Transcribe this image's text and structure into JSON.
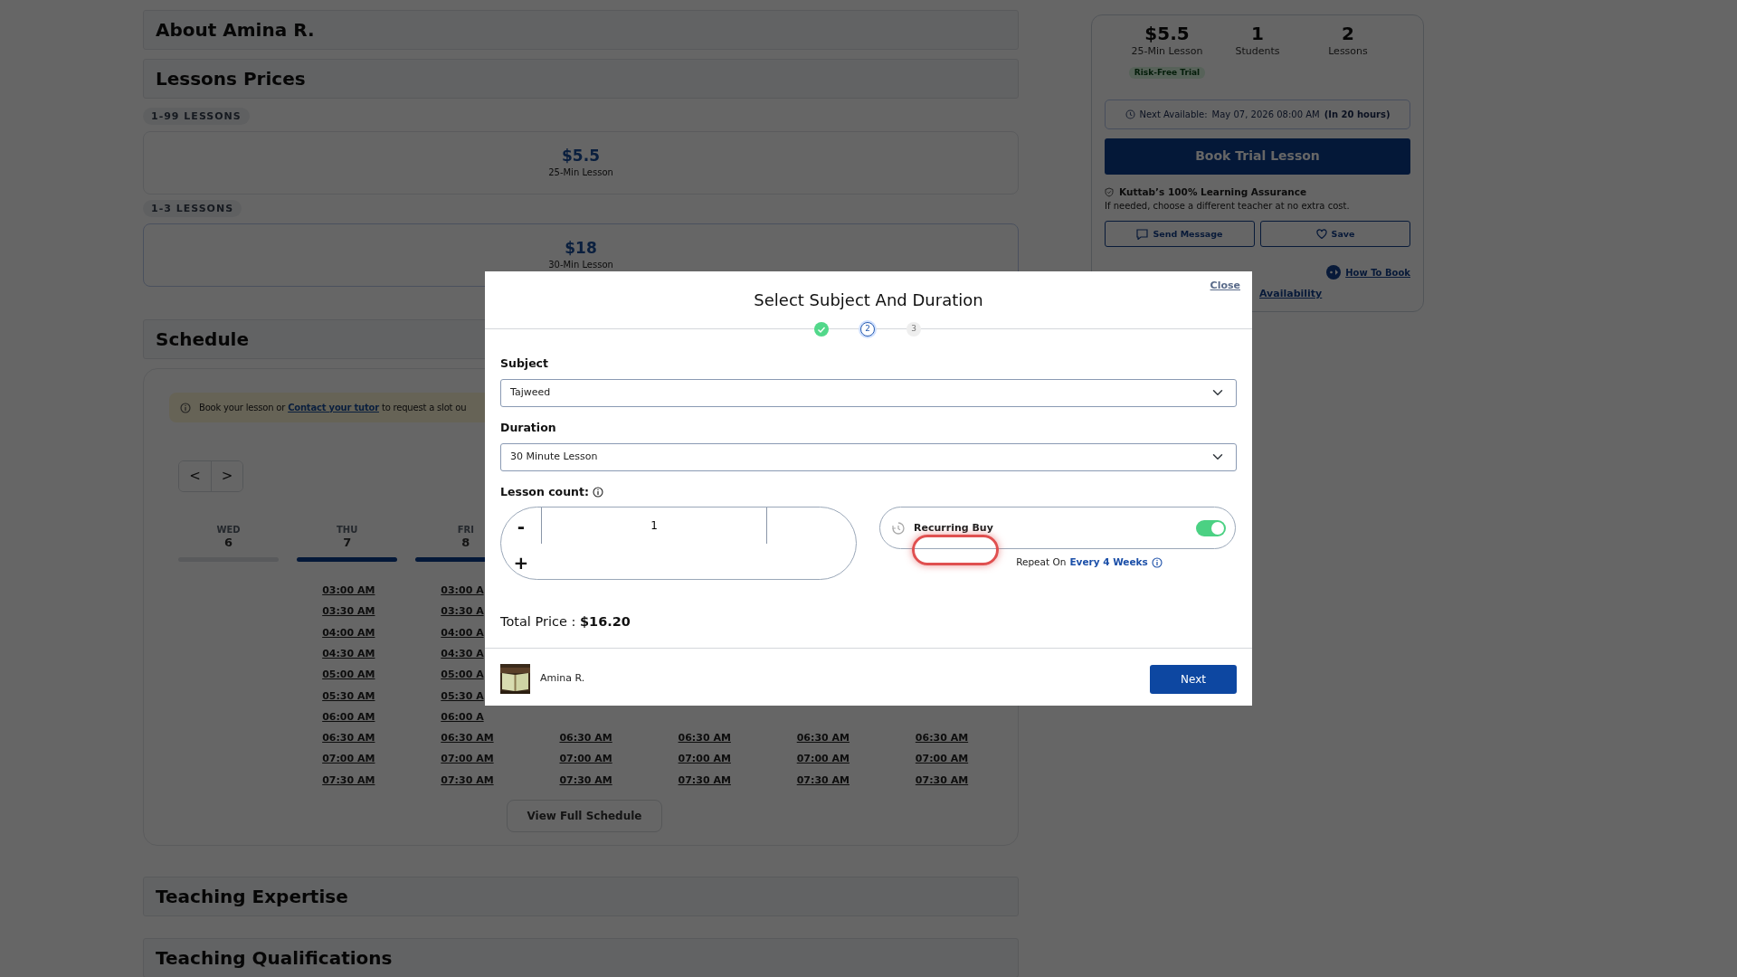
{
  "sections_top": [
    {
      "title": "About Amina R."
    },
    {
      "title": "Lessons Prices"
    }
  ],
  "price_tiers": [
    {
      "label": "1-99 LESSONS",
      "price": "$5.5",
      "unit": "25-Min Lesson",
      "selected": false
    },
    {
      "label": "1-3 LESSONS",
      "price": "$18",
      "unit": "30-Min Lesson",
      "selected": true
    }
  ],
  "schedule": {
    "title": "Schedule",
    "notice": {
      "before": "Book your lesson or ",
      "link": "Contact your tutor",
      "after": " to request a slot ou"
    },
    "prev": "<",
    "next": ">",
    "days": [
      {
        "weekday": "WED",
        "date": "6",
        "available": false
      },
      {
        "weekday": "THU",
        "date": "7",
        "available": true,
        "times": [
          "03:00 AM",
          "03:30 AM",
          "04:00 AM",
          "04:30 AM",
          "05:00 AM",
          "05:30 AM",
          "06:00 AM",
          "06:30 AM",
          "07:00 AM",
          "07:30 AM"
        ]
      },
      {
        "weekday": "FRI",
        "date": "8",
        "available": true,
        "times": [
          "03:00 A",
          "03:30 A",
          "04:00 A",
          "04:30 A",
          "05:00 A",
          "05:30 A",
          "06:00 A",
          "06:30 AM",
          "07:00 AM",
          "07:30 AM"
        ]
      },
      {
        "times": [
          "06:30 AM",
          "07:00 AM",
          "07:30 AM"
        ]
      },
      {
        "times": [
          "06:30 AM",
          "07:00 AM",
          "07:30 AM"
        ]
      },
      {
        "times": [
          "06:30 AM",
          "07:00 AM",
          "07:30 AM"
        ]
      },
      {
        "times": [
          "06:30 AM",
          "07:00 AM",
          "07:30 AM"
        ]
      }
    ],
    "full_button": "View Full Schedule"
  },
  "sections_bottom": [
    {
      "title": "Teaching Expertise"
    },
    {
      "title": "Teaching Qualifications"
    }
  ],
  "summary": {
    "stats": [
      {
        "value": "$5.5",
        "label": "25-Min Lesson",
        "badge": "Risk-Free Trial"
      },
      {
        "value": "1",
        "label": "Students"
      },
      {
        "value": "2",
        "label": "Lessons"
      }
    ],
    "next_available": {
      "label": "Next Available:",
      "date": "May 07, 2026 08:00 AM",
      "relative": "(In 20 hours)"
    },
    "book_button": "Book Trial Lesson",
    "assurance_title": "Kuttab’s 100% Learning Assurance",
    "assurance_text": "If needed, choose a different teacher at no extra cost.",
    "message_button": "Send Message",
    "save_button": "Save",
    "how_link": "How To Book",
    "availability_link": "Availability"
  },
  "modal": {
    "title": "Select Subject And Duration",
    "close": "Close",
    "steps": [
      {
        "done": true,
        "selected": false
      },
      {
        "label": "2",
        "done": false,
        "selected": true
      },
      {
        "label": "3",
        "done": false,
        "selected": false
      }
    ],
    "subject_label": "Subject",
    "subject": "Tajweed",
    "duration_label": "Duration",
    "duration": "30 Minute Lesson",
    "count_label": "Lesson count:",
    "minus": "-",
    "count": "1",
    "plus": "+",
    "recurring": {
      "label": "Recurring Buy",
      "on": true,
      "highlighted": true,
      "repeat_label": "Repeat On",
      "repeat_value": "Every 4 Weeks"
    },
    "total": "Total Price : **$16.20**",
    "tutor": {
      "name": "Amina R."
    },
    "next_button": "Next"
  }
}
